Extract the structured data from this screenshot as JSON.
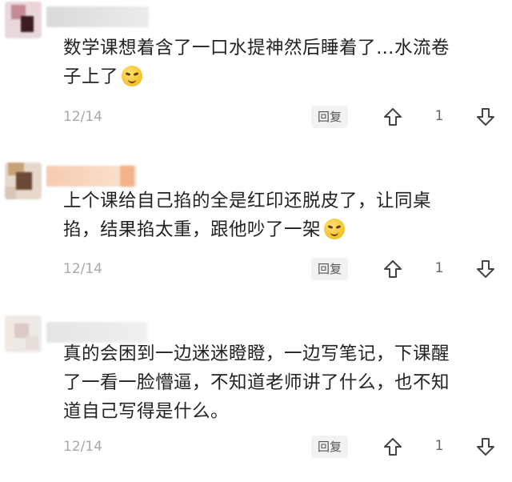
{
  "comments": [
    {
      "text_line1": "数学课想着含了一口水提神然后睡着了…水流卷",
      "text_line2": "子上了",
      "emoji": "grimace-emoji",
      "date": "12/14",
      "reply_label": "回复",
      "likes": "1"
    },
    {
      "text_line1": "上个课给自己掐的全是红印还脱皮了，让同桌",
      "text_line2": "掐，结果掐太重，跟他吵了一架",
      "emoji": "sneer-emoji",
      "date": "12/14",
      "reply_label": "回复",
      "likes": "1"
    },
    {
      "text_line1": "真的会困到一边迷迷瞪瞪，一边写笔记，下课醒",
      "text_line2": "了一看一脸懵逼，不知道老师讲了什么，也不知",
      "text_line3": "道自己写得是什么。",
      "date": "12/14",
      "reply_label": "回复",
      "likes": "1"
    }
  ],
  "colors": {
    "text": "#222222",
    "meta": "#a8a8a8",
    "reply_bg": "#f2f2f2"
  },
  "icons": {
    "upvote": "arrow-up-icon",
    "downvote": "arrow-down-icon"
  }
}
